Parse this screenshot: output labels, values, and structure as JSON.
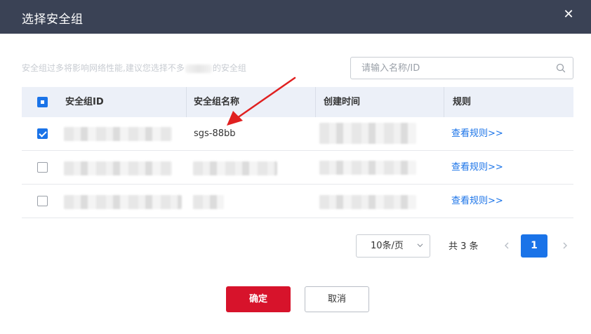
{
  "dialog": {
    "title": "选择安全组",
    "close_glyph": "✕"
  },
  "hint": {
    "prefix": "安全组过多将影响网络性能,建议您选择不多",
    "suffix": "的安全组"
  },
  "search": {
    "placeholder": "请输入名称/ID",
    "value": "",
    "icon": "search-icon"
  },
  "table": {
    "columns": [
      "安全组ID",
      "安全组名称",
      "创建时间",
      "规则"
    ],
    "rows": [
      {
        "checked": true,
        "id": "",
        "name": "sgs-88bb",
        "created": "",
        "rule_link": "查看规则>>"
      },
      {
        "checked": false,
        "id": "",
        "name": "",
        "created": "",
        "rule_link": "查看规则>>"
      },
      {
        "checked": false,
        "id": "",
        "name": "",
        "created": "",
        "rule_link": "查看规则>>"
      }
    ]
  },
  "pagination": {
    "page_size": "10条/页",
    "total_text": "共 3 条",
    "current_page": "1"
  },
  "footer": {
    "confirm_label": "确定",
    "cancel_label": "取消"
  },
  "colors": {
    "header_bg": "#3a4255",
    "accent_blue": "#1a73e8",
    "confirm_red": "#d7132b",
    "annotation_arrow": "#e02020"
  }
}
